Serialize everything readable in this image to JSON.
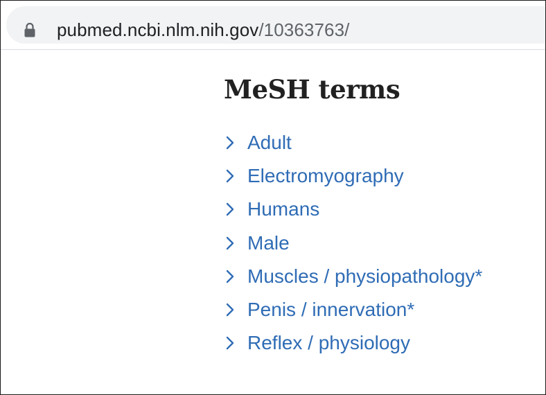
{
  "browser": {
    "url_host": "pubmed.ncbi.nlm.nih.gov",
    "url_path": "/10363763/",
    "lock_icon": "lock-icon"
  },
  "mesh": {
    "title": "MeSH terms",
    "link_color": "#2f6cb5",
    "expand_icon": "chevron-right-icon",
    "terms": [
      "Adult",
      "Electromyography",
      "Humans",
      "Male",
      "Muscles / physiopathology*",
      "Penis / innervation*",
      "Reflex / physiology"
    ]
  }
}
